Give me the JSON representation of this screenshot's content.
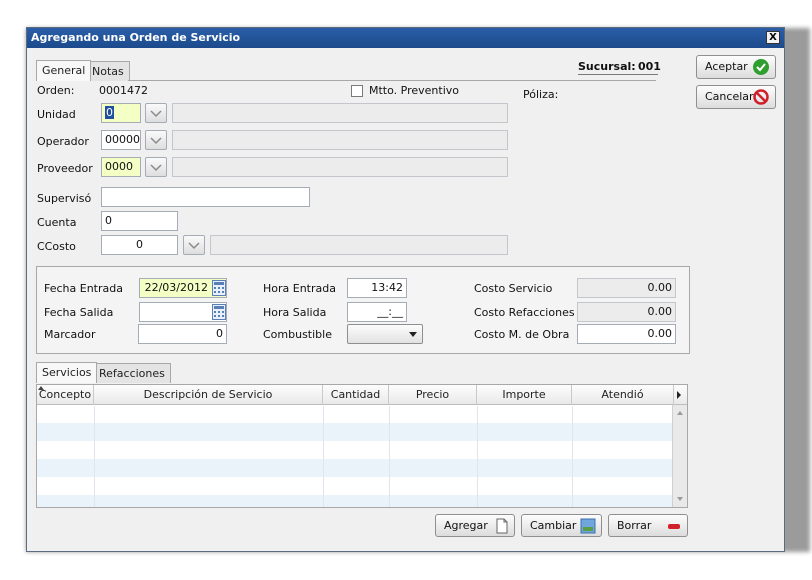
{
  "window": {
    "title": "Agregando una Orden de Servicio",
    "close_label": "X"
  },
  "tabs": [
    {
      "label": "General",
      "active": true
    },
    {
      "label": "Notas",
      "active": false
    }
  ],
  "header": {
    "sucursal_label": "Sucursal:",
    "sucursal_value": "001",
    "orden_label": "Orden:",
    "orden_value": "0001472",
    "mtto_label": "Mtto. Preventivo",
    "mtto_checked": false,
    "poliza_label": "Póliza:"
  },
  "form": {
    "unidad_label": "Unidad",
    "unidad_value": "0",
    "unidad_desc": "",
    "operador_label": "Operador",
    "operador_value": "00000",
    "operador_desc": "",
    "proveedor_label": "Proveedor",
    "proveedor_value": "0000",
    "proveedor_desc": "",
    "superviso_label": "Supervisó",
    "superviso_value": "",
    "cuenta_label": "Cuenta",
    "cuenta_value": "0",
    "ccosto_label": "CCosto",
    "ccosto_value": "0",
    "ccosto_desc": ""
  },
  "details": {
    "fecha_entrada_label": "Fecha Entrada",
    "fecha_entrada_value": "22/03/2012",
    "fecha_salida_label": "Fecha Salida",
    "fecha_salida_value": "",
    "marcador_label": "Marcador",
    "marcador_value": "0",
    "hora_entrada_label": "Hora Entrada",
    "hora_entrada_value": "13:42",
    "hora_salida_label": "Hora Salida",
    "hora_salida_value": "__:__",
    "combustible_label": "Combustible",
    "combustible_value": "",
    "costo_servicio_label": "Costo Servicio",
    "costo_servicio_value": "0.00",
    "costo_refacciones_label": "Costo Refacciones",
    "costo_refacciones_value": "0.00",
    "costo_obra_label": "Costo M. de Obra",
    "costo_obra_value": "0.00"
  },
  "grid_tabs": [
    {
      "label": "Servicios",
      "active": true
    },
    {
      "label": "Refacciones",
      "active": false
    }
  ],
  "grid": {
    "columns": [
      "Concepto",
      "Descripción de Servicio",
      "Cantidad",
      "Precio",
      "Importe",
      "Atendió"
    ],
    "rows": []
  },
  "buttons": {
    "aceptar": "Aceptar",
    "cancelar": "Cancelar",
    "agregar": "Agregar",
    "cambiar": "Cambiar",
    "borrar": "Borrar"
  },
  "colors": {
    "titlebar": "#1c4a8c",
    "required_field": "#f4ffc5",
    "accept_green": "#2e9e2e",
    "cancel_red": "#d0202a",
    "grid_alt_row": "#eaf2fa"
  },
  "icons": [
    "close-icon",
    "check-icon",
    "cancel-icon",
    "chevron-down-icon",
    "calendar-icon",
    "new-document-icon",
    "image-icon",
    "minus-icon"
  ]
}
